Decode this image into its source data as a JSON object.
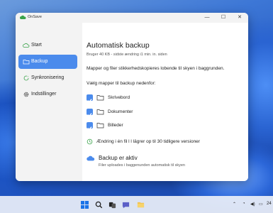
{
  "window": {
    "title": "OnSave",
    "minimize_glyph": "—",
    "maximize_glyph": "☐",
    "close_glyph": "✕"
  },
  "sidebar": {
    "items": [
      {
        "label": "Start",
        "icon": "cloud-outline-icon"
      },
      {
        "label": "Backup",
        "icon": "folder-icon",
        "active": true
      },
      {
        "label": "Synkronisering",
        "icon": "sync-icon"
      },
      {
        "label": "Indstillinger",
        "icon": "gear-icon"
      }
    ]
  },
  "main": {
    "title": "Automatisk backup",
    "subtitle": "Bruger 40 KB - sidste ændring i1 min. in. siden",
    "description": "Mapper og filer stikkerhedskopieres lobende til skyen i baggrunden.",
    "choose_label": "Vælg mapper til backup nedenfor:",
    "folders": [
      {
        "label": "Skrivebord",
        "checked": true
      },
      {
        "label": "Dokumenter",
        "checked": true
      },
      {
        "label": "Billeder",
        "checked": true
      }
    ],
    "history_text": "Ændring i én fil l l lägrer op til 30 tidligere versioner",
    "status_title": "Backup er aktiv",
    "status_sub": "Filer uploades i baggenunden automatisk til skyen"
  },
  "taskbar": {
    "icons": [
      "windows-start-icon",
      "search-icon",
      "task-view-icon",
      "chat-icon",
      "file-explorer-icon"
    ],
    "tray_time": "24"
  },
  "colors": {
    "accent": "#4b8bec",
    "app_green": "#3aa34a"
  }
}
